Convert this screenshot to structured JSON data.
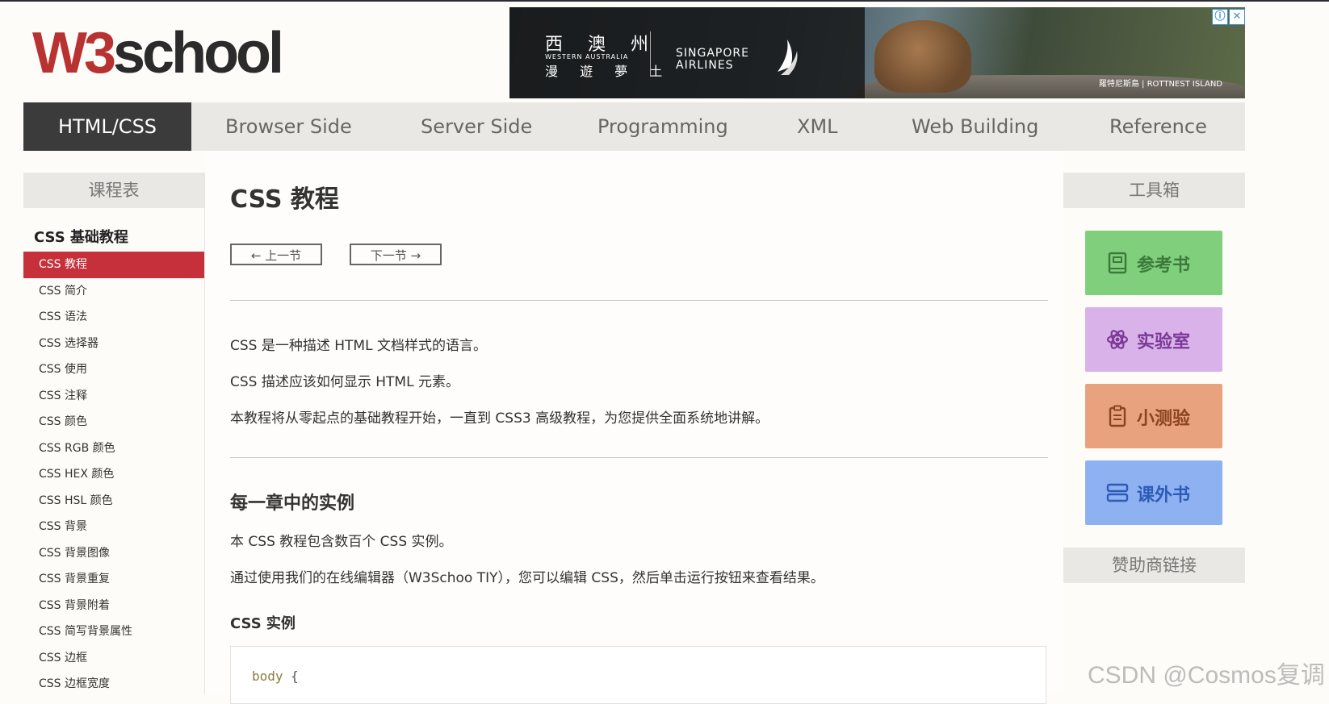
{
  "logo": {
    "w3": "W3",
    "school": "school"
  },
  "ad": {
    "cn_top": "西 澳 州",
    "en": "WESTERN AUSTRALIA",
    "cn_bottom": "漫 遊 夢 土",
    "airline_1": "SINGAPORE",
    "airline_2": "AIRLINES",
    "location": "羅特尼斯島 | ROTTNEST ISLAND",
    "info_icon": "ⓘ",
    "close_icon": "✕"
  },
  "nav": {
    "items": [
      "HTML/CSS",
      "Browser Side",
      "Server Side",
      "Programming",
      "XML",
      "Web Building",
      "Reference"
    ]
  },
  "left": {
    "title": "课程表",
    "section": "CSS 基础教程",
    "items": [
      "CSS 教程",
      "CSS 简介",
      "CSS 语法",
      "CSS 选择器",
      "CSS 使用",
      "CSS 注释",
      "CSS 颜色",
      "CSS RGB 颜色",
      "CSS HEX 颜色",
      "CSS HSL 颜色",
      "CSS 背景",
      "CSS 背景图像",
      "CSS 背景重复",
      "CSS 背景附着",
      "CSS 简写背景属性",
      "CSS 边框",
      "CSS 边框宽度"
    ]
  },
  "main": {
    "title": "CSS 教程",
    "prev": "← 上一节",
    "next": "下一节 →",
    "p1": "CSS 是一种描述 HTML 文档样式的语言。",
    "p2": "CSS 描述应该如何显示 HTML 元素。",
    "p3": "本教程将从零起点的基础教程开始，一直到 CSS3 高级教程，为您提供全面系统地讲解。",
    "h2": "每一章中的实例",
    "p4": "本 CSS 教程包含数百个 CSS 实例。",
    "p5": "通过使用我们的在线编辑器（W3Schoo TIY），您可以编辑 CSS，然后单击运行按钮来查看结果。",
    "h3": "CSS 实例",
    "code_kw": "body",
    "code_brace": " {"
  },
  "right": {
    "title": "工具箱",
    "tools": [
      "参考书",
      "实验室",
      "小测验",
      "课外书"
    ],
    "sponsor": "赞助商链接"
  },
  "watermark": "CSDN @Cosmos复调"
}
